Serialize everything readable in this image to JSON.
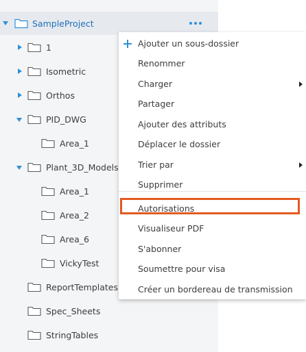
{
  "tree": {
    "root": {
      "label": "SampleProject",
      "more_label": "•••"
    },
    "items": [
      {
        "label": "1",
        "level": 1,
        "caret": "right"
      },
      {
        "label": "Isometric",
        "level": 1,
        "caret": "right"
      },
      {
        "label": "Orthos",
        "level": 1,
        "caret": "right"
      },
      {
        "label": "PID_DWG",
        "level": 1,
        "caret": "down"
      },
      {
        "label": "Area_1",
        "level": 2,
        "caret": "none"
      },
      {
        "label": "Plant_3D_Models",
        "level": 1,
        "caret": "down"
      },
      {
        "label": "Area_1",
        "level": 2,
        "caret": "none"
      },
      {
        "label": "Area_2",
        "level": 2,
        "caret": "none"
      },
      {
        "label": "Area_6",
        "level": 2,
        "caret": "none"
      },
      {
        "label": "VickyTest",
        "level": 2,
        "caret": "none"
      },
      {
        "label": "ReportTemplates",
        "level": 1,
        "caret": "none"
      },
      {
        "label": "Spec_Sheets",
        "level": 1,
        "caret": "none"
      },
      {
        "label": "StringTables",
        "level": 1,
        "caret": "none"
      }
    ]
  },
  "context_menu": {
    "items": [
      {
        "label": "Ajouter un sous-dossier",
        "icon": "plus-icon"
      },
      {
        "label": "Renommer"
      },
      {
        "label": "Charger",
        "submenu": true
      },
      {
        "label": "Partager"
      },
      {
        "label": "Ajouter des attributs"
      },
      {
        "label": "Déplacer le dossier"
      },
      {
        "label": "Trier par",
        "submenu": true
      },
      {
        "label": "Supprimer"
      },
      {
        "label": "Autorisations",
        "highlighted": true
      },
      {
        "label": "Visualiseur PDF"
      },
      {
        "label": "S'abonner"
      },
      {
        "label": "Soumettre pour visa"
      },
      {
        "label": "Créer un bordereau de transmission"
      }
    ]
  },
  "colors": {
    "accent": "#2f8fd8",
    "highlight_border": "#e35a1e",
    "panel_bg": "#f4f5f6",
    "root_bg": "#e6eaef"
  }
}
